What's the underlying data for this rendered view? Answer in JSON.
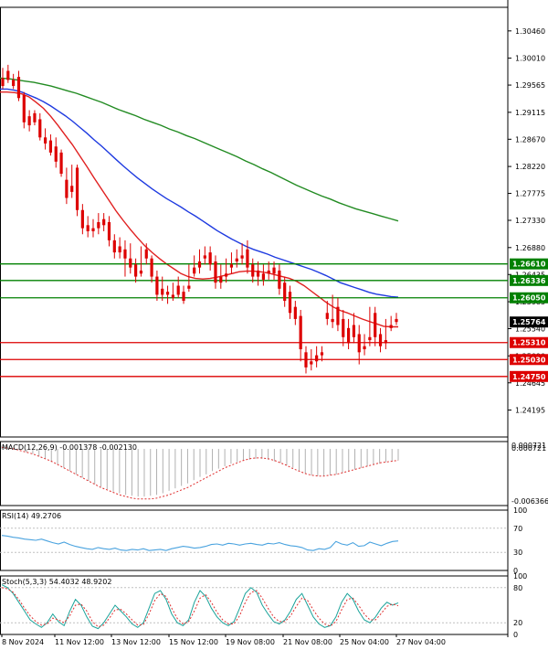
{
  "chart_data": {
    "type": "candlestick",
    "instrument_timeframe": "",
    "main": {
      "price_range": [
        1.2375,
        1.3085
      ],
      "y_ticks": [
        "1.30460",
        "1.30010",
        "1.29565",
        "1.29115",
        "1.28670",
        "1.28220",
        "1.27775",
        "1.27330",
        "1.26880",
        "1.26435",
        "1.25985",
        "1.25540",
        "1.25090",
        "1.24645",
        "1.24195"
      ],
      "x_ticks": [
        "8 Nov 2024",
        "11 Nov 12:00",
        "13 Nov 12:00",
        "15 Nov 12:00",
        "19 Nov 08:00",
        "21 Nov 08:00",
        "25 Nov 04:00",
        "27 Nov 04:00"
      ],
      "current_price_label": "1.25764",
      "levels": [
        {
          "value": 1.2661,
          "label": "1.26610",
          "color": "#008000"
        },
        {
          "value": 1.26336,
          "label": "1.26336",
          "color": "#008000"
        },
        {
          "value": 1.2605,
          "label": "1.26050",
          "color": "#008000"
        },
        {
          "value": 1.2531,
          "label": "1.25310",
          "color": "#dd0000"
        },
        {
          "value": 1.2503,
          "label": "1.25030",
          "color": "#dd0000"
        },
        {
          "value": 1.2475,
          "label": "1.24750",
          "color": "#dd0000"
        }
      ],
      "candles": [
        [
          1.2968,
          1.2985,
          1.2955,
          1.295
        ],
        [
          1.298,
          1.299,
          1.2965,
          1.296
        ],
        [
          1.2965,
          1.2975,
          1.2955,
          1.295
        ],
        [
          1.297,
          1.298,
          1.2935,
          1.293
        ],
        [
          1.294,
          1.2945,
          1.2895,
          1.2885
        ],
        [
          1.2905,
          1.2915,
          1.289,
          1.288
        ],
        [
          1.291,
          1.2915,
          1.2895,
          1.289
        ],
        [
          1.29,
          1.291,
          1.287,
          1.2865
        ],
        [
          1.287,
          1.2885,
          1.286,
          1.285
        ],
        [
          1.2865,
          1.2875,
          1.2845,
          1.284
        ],
        [
          1.2855,
          1.287,
          1.283,
          1.282
        ],
        [
          1.2845,
          1.285,
          1.281,
          1.2805
        ],
        [
          1.28,
          1.282,
          1.277,
          1.276
        ],
        [
          1.279,
          1.2825,
          1.278,
          1.277
        ],
        [
          1.282,
          1.2825,
          1.275,
          1.274
        ],
        [
          1.275,
          1.276,
          1.272,
          1.271
        ],
        [
          1.2725,
          1.274,
          1.2715,
          1.2705
        ],
        [
          1.272,
          1.2735,
          1.2715,
          1.2705
        ],
        [
          1.273,
          1.2745,
          1.272,
          1.271
        ],
        [
          1.2735,
          1.2745,
          1.2725,
          1.2715
        ],
        [
          1.273,
          1.274,
          1.27,
          1.269
        ],
        [
          1.27,
          1.271,
          1.268,
          1.267
        ],
        [
          1.269,
          1.2705,
          1.268,
          1.267
        ],
        [
          1.2685,
          1.27,
          1.267,
          1.264
        ],
        [
          1.267,
          1.2695,
          1.2655,
          1.2645
        ],
        [
          1.266,
          1.267,
          1.264,
          1.263
        ],
        [
          1.265,
          1.269,
          1.2645,
          1.264
        ],
        [
          1.2685,
          1.2695,
          1.267,
          1.266
        ],
        [
          1.267,
          1.2675,
          1.264,
          1.263
        ],
        [
          1.264,
          1.265,
          1.261,
          1.26
        ],
        [
          1.262,
          1.264,
          1.261,
          1.26
        ],
        [
          1.2615,
          1.2625,
          1.261,
          1.2595
        ],
        [
          1.261,
          1.263,
          1.2605,
          1.26
        ],
        [
          1.2625,
          1.264,
          1.261,
          1.2605
        ],
        [
          1.2615,
          1.2625,
          1.26,
          1.2595
        ],
        [
          1.2625,
          1.266,
          1.262,
          1.2615
        ],
        [
          1.2655,
          1.2675,
          1.2645,
          1.264
        ],
        [
          1.2665,
          1.2685,
          1.2655,
          1.2645
        ],
        [
          1.2675,
          1.269,
          1.267,
          1.266
        ],
        [
          1.268,
          1.269,
          1.266,
          1.265
        ],
        [
          1.2665,
          1.2675,
          1.263,
          1.262
        ],
        [
          1.264,
          1.266,
          1.263,
          1.262
        ],
        [
          1.2645,
          1.267,
          1.264,
          1.263
        ],
        [
          1.266,
          1.268,
          1.2655,
          1.2645
        ],
        [
          1.267,
          1.2685,
          1.2665,
          1.2655
        ],
        [
          1.2675,
          1.2695,
          1.267,
          1.266
        ],
        [
          1.2685,
          1.27,
          1.2655,
          1.2645
        ],
        [
          1.266,
          1.267,
          1.264,
          1.263
        ],
        [
          1.265,
          1.2665,
          1.264,
          1.2625
        ],
        [
          1.2645,
          1.266,
          1.2635,
          1.2625
        ],
        [
          1.265,
          1.2665,
          1.2645,
          1.2635
        ],
        [
          1.2655,
          1.2665,
          1.2645,
          1.2635
        ],
        [
          1.265,
          1.266,
          1.262,
          1.261
        ],
        [
          1.263,
          1.264,
          1.26,
          1.259
        ],
        [
          1.2615,
          1.2625,
          1.258,
          1.257
        ],
        [
          1.259,
          1.26,
          1.257,
          1.256
        ],
        [
          1.2575,
          1.2585,
          1.252,
          1.25
        ],
        [
          1.2515,
          1.2525,
          1.249,
          1.248
        ],
        [
          1.25,
          1.252,
          1.2495,
          1.2485
        ],
        [
          1.251,
          1.2525,
          1.25,
          1.249
        ],
        [
          1.2515,
          1.2525,
          1.251,
          1.25
        ],
        [
          1.258,
          1.26,
          1.257,
          1.256
        ],
        [
          1.257,
          1.261,
          1.2565,
          1.2555
        ],
        [
          1.259,
          1.2605,
          1.256,
          1.255
        ],
        [
          1.257,
          1.2585,
          1.254,
          1.2525
        ],
        [
          1.2555,
          1.257,
          1.253,
          1.252
        ],
        [
          1.256,
          1.258,
          1.254,
          1.253
        ],
        [
          1.2545,
          1.256,
          1.2515,
          1.2495
        ],
        [
          1.2525,
          1.2545,
          1.252,
          1.251
        ],
        [
          1.254,
          1.259,
          1.2535,
          1.2525
        ],
        [
          1.258,
          1.259,
          1.254,
          1.2525
        ],
        [
          1.2545,
          1.2555,
          1.2525,
          1.2515
        ],
        [
          1.2535,
          1.257,
          1.253,
          1.252
        ],
        [
          1.256,
          1.2575,
          1.2555,
          1.255
        ],
        [
          1.257,
          1.258,
          1.2565,
          1.256
        ]
      ],
      "candle_color_up": "#008000",
      "candle_color_down": "#dd0000",
      "ma_green": [
        1.2968,
        1.2967,
        1.2965,
        1.2963,
        1.2961,
        1.2958,
        1.2955,
        1.2951,
        1.2947,
        1.2943,
        1.2938,
        1.2933,
        1.2928,
        1.2922,
        1.2916,
        1.2911,
        1.2906,
        1.29,
        1.2895,
        1.289,
        1.2884,
        1.2879,
        1.2873,
        1.2868,
        1.2862,
        1.2856,
        1.285,
        1.2844,
        1.2838,
        1.2831,
        1.2825,
        1.2818,
        1.2812,
        1.2805,
        1.2798,
        1.2791,
        1.2785,
        1.2779,
        1.2773,
        1.2768,
        1.2762,
        1.2757,
        1.2752,
        1.2748,
        1.2744,
        1.274,
        1.2736,
        1.2732
      ],
      "ma_blue": [
        1.295,
        1.295,
        1.2948,
        1.2945,
        1.294,
        1.2935,
        1.2929,
        1.2922,
        1.2914,
        1.2906,
        1.2897,
        1.2887,
        1.2877,
        1.2866,
        1.2856,
        1.2845,
        1.2834,
        1.2823,
        1.2813,
        1.2803,
        1.2794,
        1.2785,
        1.2777,
        1.2769,
        1.2762,
        1.2755,
        1.2747,
        1.274,
        1.2732,
        1.2724,
        1.2716,
        1.2709,
        1.2702,
        1.2696,
        1.269,
        1.2685,
        1.2681,
        1.2677,
        1.2672,
        1.2668,
        1.2664,
        1.266,
        1.2656,
        1.2652,
        1.2647,
        1.2642,
        1.2636,
        1.263,
        1.2626,
        1.2622,
        1.2618,
        1.2614,
        1.2611,
        1.2609,
        1.2607,
        1.2606
      ],
      "ma_red": [
        1.2945,
        1.2945,
        1.2944,
        1.2942,
        1.2937,
        1.2928,
        1.2918,
        1.2905,
        1.289,
        1.2874,
        1.2858,
        1.284,
        1.2822,
        1.2803,
        1.2785,
        1.2767,
        1.2749,
        1.2733,
        1.2718,
        1.2704,
        1.2691,
        1.268,
        1.267,
        1.2661,
        1.2653,
        1.2645,
        1.264,
        1.2637,
        1.2636,
        1.2637,
        1.2639,
        1.2642,
        1.2645,
        1.2648,
        1.2649,
        1.2649,
        1.2648,
        1.2646,
        1.2643,
        1.264,
        1.2637,
        1.2632,
        1.2625,
        1.2616,
        1.2607,
        1.2598,
        1.259,
        1.2584,
        1.258,
        1.2575,
        1.257,
        1.2566,
        1.2562,
        1.2558,
        1.2557,
        1.2557
      ]
    },
    "macd": {
      "label": "MACD(12,26,9) -0.001378 -0.002130",
      "y_range": [
        -0.0069,
        0.0009
      ],
      "y_ticks": [
        "0.000721",
        "0.000721",
        "-0.006366"
      ],
      "histogram": [
        0.0004,
        0.0003,
        0.0001,
        -0.0001,
        -0.0004,
        -0.0006,
        -0.0009,
        -0.0012,
        -0.0016,
        -0.0019,
        -0.0023,
        -0.0027,
        -0.0031,
        -0.0035,
        -0.0039,
        -0.0043,
        -0.0046,
        -0.0049,
        -0.0052,
        -0.0054,
        -0.0056,
        -0.0057,
        -0.0058,
        -0.0058,
        -0.0057,
        -0.0056,
        -0.0054,
        -0.0051,
        -0.0048,
        -0.0045,
        -0.0042,
        -0.0038,
        -0.0034,
        -0.0031,
        -0.0027,
        -0.0024,
        -0.0021,
        -0.0018,
        -0.0016,
        -0.0014,
        -0.0013,
        -0.0012,
        -0.0012,
        -0.0013,
        -0.0015,
        -0.0017,
        -0.002,
        -0.0023,
        -0.0027,
        -0.003,
        -0.0032,
        -0.0033,
        -0.0033,
        -0.0032,
        -0.0031,
        -0.0029,
        -0.0027,
        -0.0025,
        -0.0023,
        -0.0021,
        -0.0019,
        -0.0018,
        -0.0016,
        -0.0015,
        -0.0014
      ],
      "signal": [
        0.0002,
        0.0001,
        0.0,
        -0.0002,
        -0.0004,
        -0.0006,
        -0.0009,
        -0.0012,
        -0.0015,
        -0.0019,
        -0.0023,
        -0.0027,
        -0.0031,
        -0.0035,
        -0.0039,
        -0.0043,
        -0.0047,
        -0.005,
        -0.0053,
        -0.0056,
        -0.0058,
        -0.006,
        -0.0061,
        -0.0061,
        -0.0061,
        -0.006,
        -0.0058,
        -0.0056,
        -0.0053,
        -0.005,
        -0.0047,
        -0.0043,
        -0.0039,
        -0.0035,
        -0.0031,
        -0.0027,
        -0.0023,
        -0.002,
        -0.0017,
        -0.0014,
        -0.0012,
        -0.0011,
        -0.0011,
        -0.0012,
        -0.0014,
        -0.0017,
        -0.002,
        -0.0024,
        -0.0027,
        -0.003,
        -0.0032,
        -0.0033,
        -0.0033,
        -0.0032,
        -0.0031,
        -0.0029,
        -0.0027,
        -0.0025,
        -0.0023,
        -0.0021,
        -0.0019,
        -0.0017,
        -0.0016,
        -0.0015,
        -0.0014
      ]
    },
    "rsi": {
      "label": "RSI(14) 49.2706",
      "y_range": [
        0,
        100
      ],
      "y_ticks": [
        {
          "label": "100",
          "v": 100
        },
        {
          "label": "70",
          "v": 70
        },
        {
          "label": "30",
          "v": 30
        },
        {
          "label": "0",
          "v": 0
        }
      ],
      "values": [
        58,
        57,
        55,
        54,
        52,
        51,
        50,
        52,
        49,
        46,
        44,
        47,
        43,
        40,
        38,
        36,
        35,
        38,
        36,
        35,
        37,
        34,
        33,
        35,
        34,
        36,
        33,
        34,
        35,
        33,
        36,
        38,
        40,
        39,
        37,
        38,
        40,
        43,
        44,
        42,
        45,
        44,
        42,
        44,
        45,
        43,
        42,
        45,
        44,
        46,
        43,
        41,
        40,
        38,
        34,
        33,
        36,
        35,
        38,
        48,
        44,
        42,
        46,
        40,
        41,
        47,
        44,
        41,
        45,
        48,
        49
      ]
    },
    "stoch": {
      "label": "Stoch(5,3,3) 54.4032 48.9202",
      "y_range": [
        0,
        100
      ],
      "y_ticks": [
        {
          "label": "100",
          "v": 100
        },
        {
          "label": "80",
          "v": 80
        },
        {
          "label": "20",
          "v": 20
        },
        {
          "label": "0",
          "v": 0
        }
      ],
      "k": [
        85,
        80,
        70,
        55,
        40,
        25,
        18,
        12,
        20,
        35,
        22,
        15,
        40,
        60,
        50,
        30,
        14,
        10,
        20,
        35,
        50,
        40,
        30,
        18,
        12,
        20,
        45,
        70,
        75,
        60,
        35,
        20,
        15,
        25,
        55,
        75,
        65,
        45,
        30,
        20,
        15,
        22,
        45,
        70,
        80,
        72,
        50,
        35,
        22,
        18,
        25,
        40,
        60,
        70,
        50,
        30,
        18,
        12,
        15,
        30,
        55,
        70,
        60,
        40,
        25,
        20,
        30,
        45,
        55,
        50,
        54
      ],
      "d": [
        80,
        78,
        72,
        60,
        45,
        32,
        22,
        16,
        18,
        28,
        25,
        20,
        32,
        50,
        52,
        40,
        22,
        13,
        16,
        28,
        42,
        43,
        35,
        25,
        16,
        17,
        35,
        58,
        70,
        65,
        45,
        27,
        18,
        22,
        40,
        62,
        68,
        55,
        38,
        25,
        18,
        18,
        32,
        55,
        72,
        75,
        62,
        45,
        30,
        22,
        22,
        32,
        48,
        62,
        58,
        42,
        28,
        18,
        14,
        22,
        42,
        60,
        62,
        50,
        35,
        25,
        25,
        36,
        48,
        52,
        49
      ]
    },
    "colors": {
      "ma_green": "#228b22",
      "ma_blue": "#1e3ae0",
      "ma_red": "#e02020",
      "macd_signal": "#e03030",
      "macd_hist": "#b0b0b0",
      "rsi": "#4aa3df",
      "stoch_k": "#1aa39a",
      "stoch_d": "#e03030"
    }
  }
}
